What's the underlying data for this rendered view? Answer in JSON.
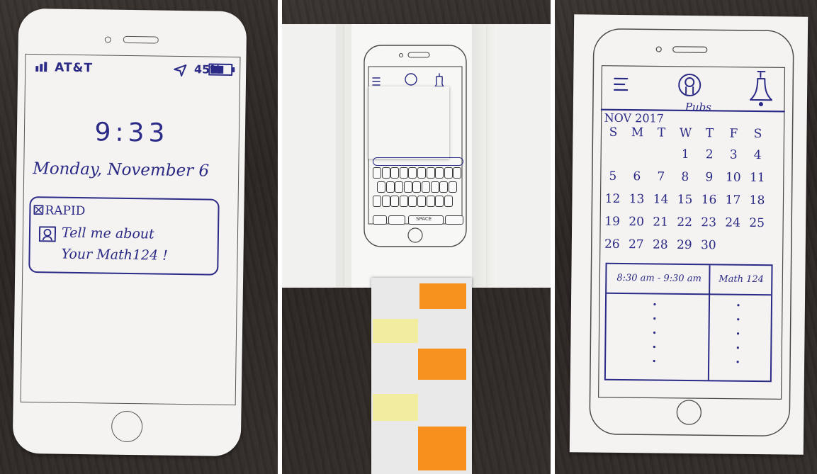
{
  "lockscreen": {
    "carrier": "AT&T",
    "battery": "45%",
    "time": "9:33",
    "date": "Monday, November 6",
    "notification": {
      "app": "RAPID",
      "line1": "Tell me about",
      "line2": "Your Math124 !"
    }
  },
  "keyboard_screen": {
    "space_label": "SPACE"
  },
  "calendar_screen": {
    "app_label": "Pubs",
    "month": "NOV 2017",
    "weekdays": [
      "S",
      "M",
      "T",
      "W",
      "T",
      "F",
      "S"
    ],
    "weeks": [
      [
        "",
        "",
        "",
        "1",
        "2",
        "3",
        "4"
      ],
      [
        "5",
        "6",
        "7",
        "8",
        "9",
        "10",
        "11"
      ],
      [
        "12",
        "13",
        "14",
        "15",
        "16",
        "17",
        "18"
      ],
      [
        "19",
        "20",
        "21",
        "22",
        "23",
        "24",
        "25"
      ],
      [
        "26",
        "27",
        "28",
        "29",
        "30",
        "",
        ""
      ]
    ],
    "event": {
      "time": "8:30 am - 9:30 am",
      "course": "Math 124"
    }
  },
  "icons": [
    "signal-bars-icon",
    "location-arrow-icon",
    "battery-icon",
    "rapid-app-icon",
    "menu-icon",
    "profile-icon",
    "bell-icon"
  ],
  "colors": {
    "ink": "#2b2a86",
    "orange": "#f7931e",
    "yellow": "#f1e9a0",
    "wood": "#2e2925"
  }
}
